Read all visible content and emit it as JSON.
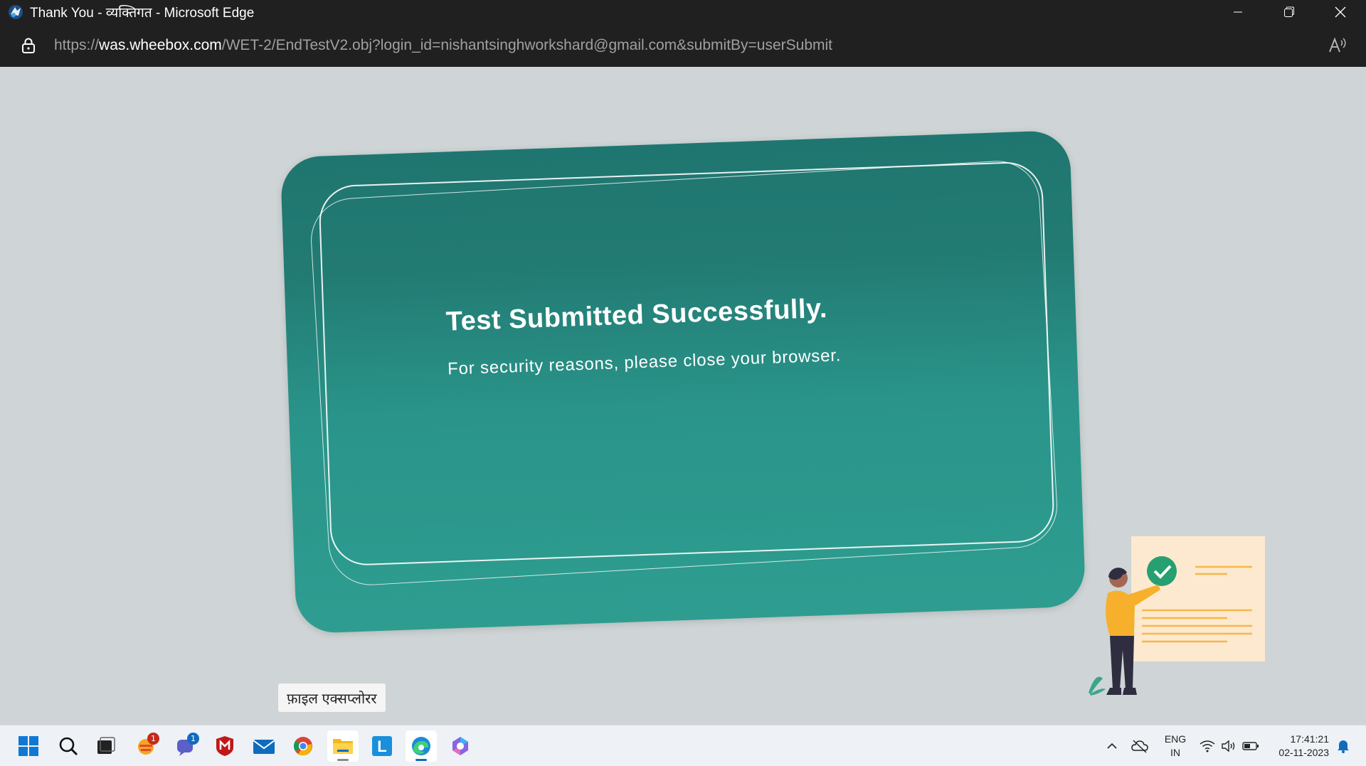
{
  "window": {
    "title": "Thank You - व्यक्तिगत - Microsoft Edge",
    "icons": {
      "app": "edge-profile-icon",
      "minimize": "minimize-icon",
      "restore": "restore-icon",
      "close": "close-icon"
    }
  },
  "addressbar": {
    "url_prefix": "https://",
    "url_host": "was.wheebox.com",
    "url_path": "/WET-2/EndTestV2.obj?login_id=nishantsinghworkshard@gmail.com&submitBy=userSubmit",
    "icons": {
      "lock": "lock-icon",
      "read_aloud": "read-aloud-icon"
    }
  },
  "page": {
    "heading": "Test Submitted Successfully.",
    "subtext": "For security reasons, please close your browser.",
    "colors": {
      "card_top": "#1f7670",
      "card_bottom": "#2e9d90",
      "background": "#cfd5d6"
    }
  },
  "tooltip": {
    "text": "फ़ाइल एक्सप्लोरर"
  },
  "taskbar": {
    "apps": [
      {
        "name": "start",
        "icon": "windows-start-icon"
      },
      {
        "name": "search",
        "icon": "search-icon"
      },
      {
        "name": "task-view",
        "icon": "task-view-icon"
      },
      {
        "name": "widgets",
        "icon": "widgets-icon",
        "badge": "1"
      },
      {
        "name": "teams-chat",
        "icon": "chat-icon",
        "badge": "1"
      },
      {
        "name": "mcafee",
        "icon": "mcafee-icon"
      },
      {
        "name": "mail",
        "icon": "mail-icon"
      },
      {
        "name": "chrome",
        "icon": "chrome-icon"
      },
      {
        "name": "file-explorer",
        "icon": "folder-icon"
      },
      {
        "name": "l-app",
        "icon": "l-app-icon",
        "label": "L"
      },
      {
        "name": "edge",
        "icon": "edge-icon"
      },
      {
        "name": "copilot",
        "icon": "copilot-icon"
      }
    ],
    "tray": {
      "lang_top": "ENG",
      "lang_bottom": "IN",
      "time": "17:41:21",
      "date": "02-11-2023",
      "icons": [
        "chevron-up-icon",
        "onedrive-offline-icon",
        "wifi-icon",
        "volume-icon",
        "battery-icon",
        "notification-bell-icon"
      ]
    }
  }
}
